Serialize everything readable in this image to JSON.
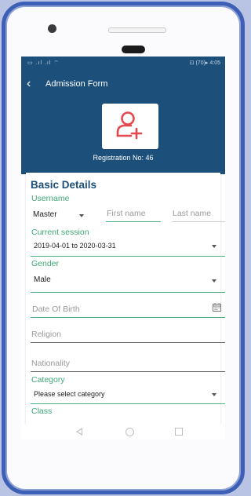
{
  "status_bar": {
    "left": "▭ .ıl .ıl ⌔",
    "right": "⊡ (70)▸ 4:05"
  },
  "appbar": {
    "back_icon": "‹",
    "title": "Admission Form"
  },
  "avatar": {
    "icon": "add-user-icon",
    "color": "#e5484d"
  },
  "registration": "Registration No: 46",
  "form": {
    "heading": "Basic Details",
    "username_label": "Username",
    "salutation": "Master",
    "first_name_placeholder": "First name",
    "last_name_placeholder": "Last name",
    "session_label": "Current session",
    "session_value": "2019-04-01 to 2020-03-31",
    "gender_label": "Gender",
    "gender_value": "Male",
    "dob_placeholder": "Date Of Birth",
    "religion_placeholder": "Religion",
    "nationality_placeholder": "Nationality",
    "category_label": "Category",
    "category_value": "Please select category",
    "class_label": "Class"
  },
  "colors": {
    "primary": "#1c4f79",
    "accent": "#3ea878",
    "frame": "#3d5fb5"
  }
}
